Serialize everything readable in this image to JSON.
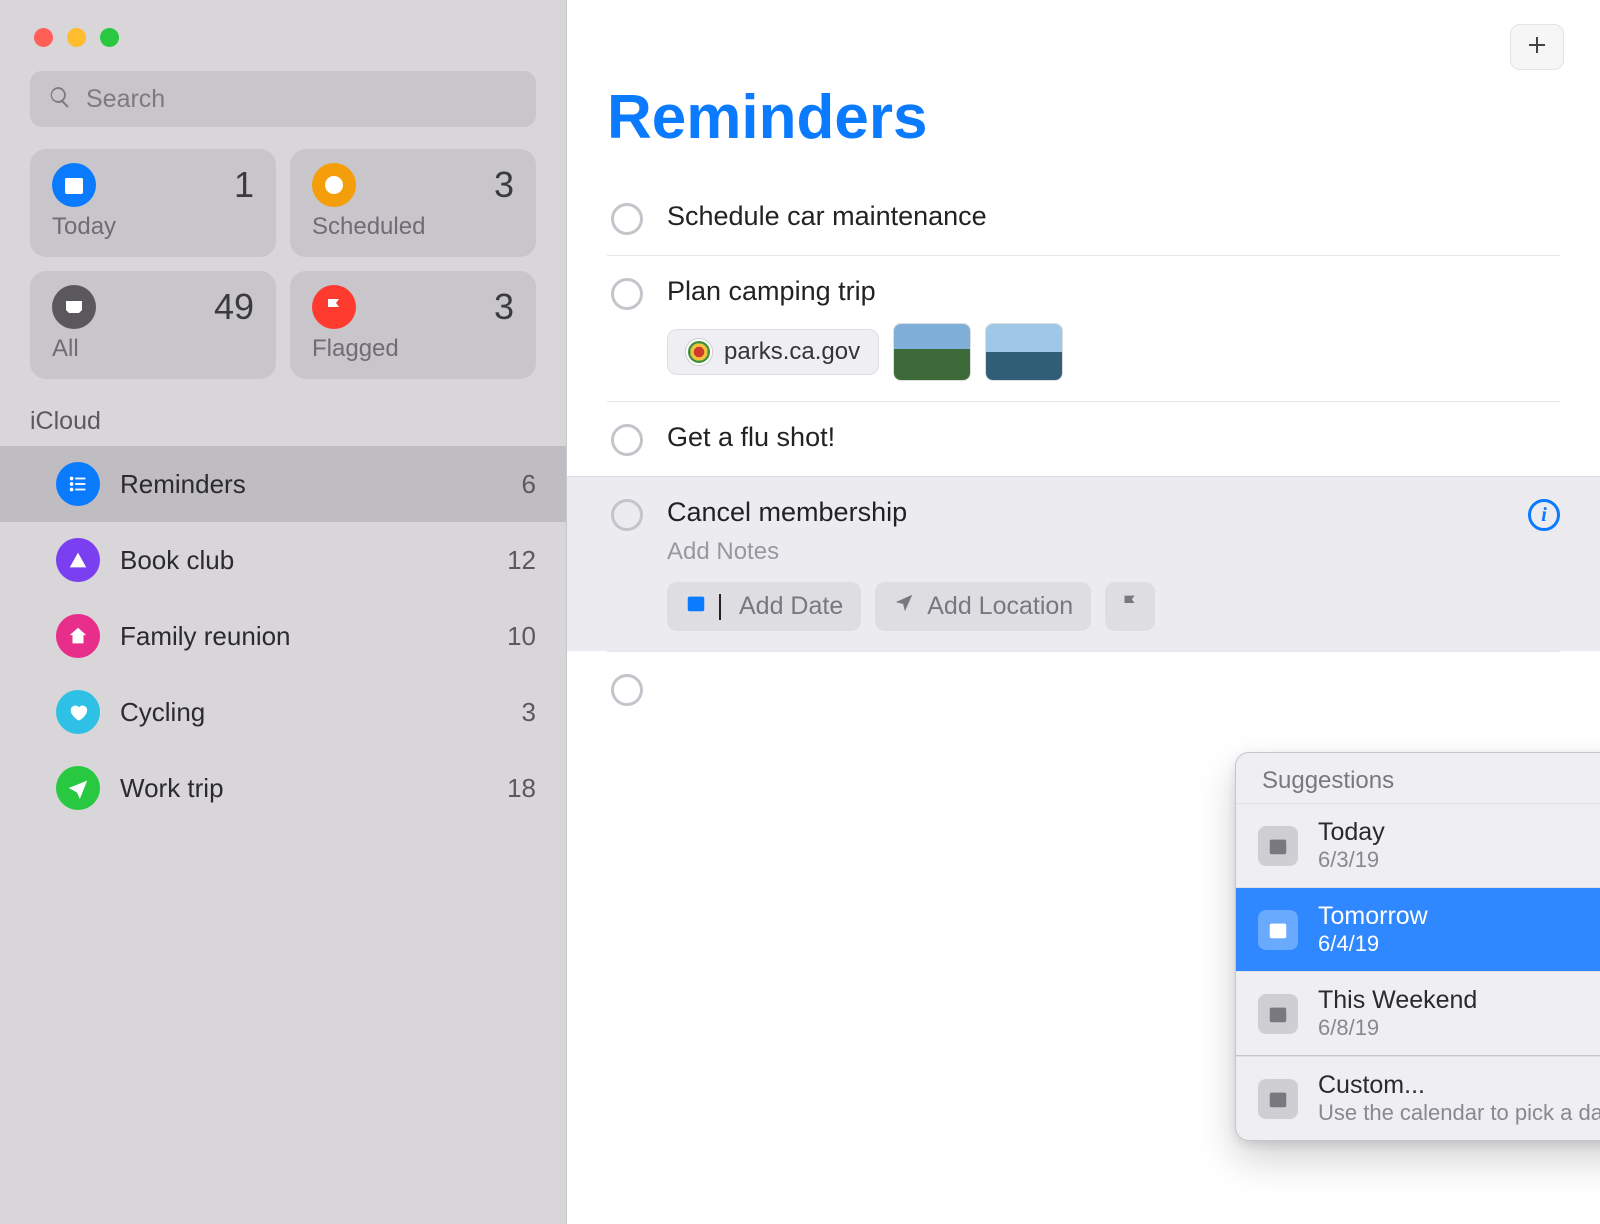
{
  "colors": {
    "accent": "#0a7bff",
    "today": "#0a7bff",
    "scheduled": "#f59e0b",
    "all": "#5a585d",
    "flagged": "#ff3b30",
    "list_reminders": "#0a7bff",
    "list_bookclub": "#7a3ff0",
    "list_family": "#e62e8a",
    "list_cycling": "#2fc0e6",
    "list_worktrip": "#28c840"
  },
  "search": {
    "placeholder": "Search"
  },
  "smart_lists": {
    "today": {
      "label": "Today",
      "count": "1"
    },
    "scheduled": {
      "label": "Scheduled",
      "count": "3"
    },
    "all": {
      "label": "All",
      "count": "49"
    },
    "flagged": {
      "label": "Flagged",
      "count": "3"
    }
  },
  "section_label": "iCloud",
  "lists": [
    {
      "name": "Reminders",
      "count": "6",
      "color": "#0a7bff",
      "icon": "list",
      "selected": true
    },
    {
      "name": "Book club",
      "count": "12",
      "color": "#7a3ff0",
      "icon": "tent",
      "selected": false
    },
    {
      "name": "Family reunion",
      "count": "10",
      "color": "#e62e8a",
      "icon": "house",
      "selected": false
    },
    {
      "name": "Cycling",
      "count": "3",
      "color": "#2fc0e6",
      "icon": "heart",
      "selected": false
    },
    {
      "name": "Work trip",
      "count": "18",
      "color": "#28c840",
      "icon": "plane",
      "selected": false
    }
  ],
  "main": {
    "title": "Reminders",
    "reminders": [
      {
        "title": "Schedule car maintenance"
      },
      {
        "title": "Plan camping trip",
        "link_label": "parks.ca.gov"
      },
      {
        "title": "Get a flu shot!"
      },
      {
        "title": "Cancel membership",
        "notes_placeholder": "Add Notes",
        "add_date_label": "Add Date",
        "add_location_label": "Add Location",
        "selected": true
      }
    ]
  },
  "popover": {
    "header": "Suggestions",
    "items": [
      {
        "title": "Today",
        "sub": "6/3/19",
        "selected": false
      },
      {
        "title": "Tomorrow",
        "sub": "6/4/19",
        "selected": true
      },
      {
        "title": "This Weekend",
        "sub": "6/8/19",
        "selected": false
      }
    ],
    "custom": {
      "title": "Custom...",
      "sub": "Use the calendar to pick a date"
    }
  }
}
